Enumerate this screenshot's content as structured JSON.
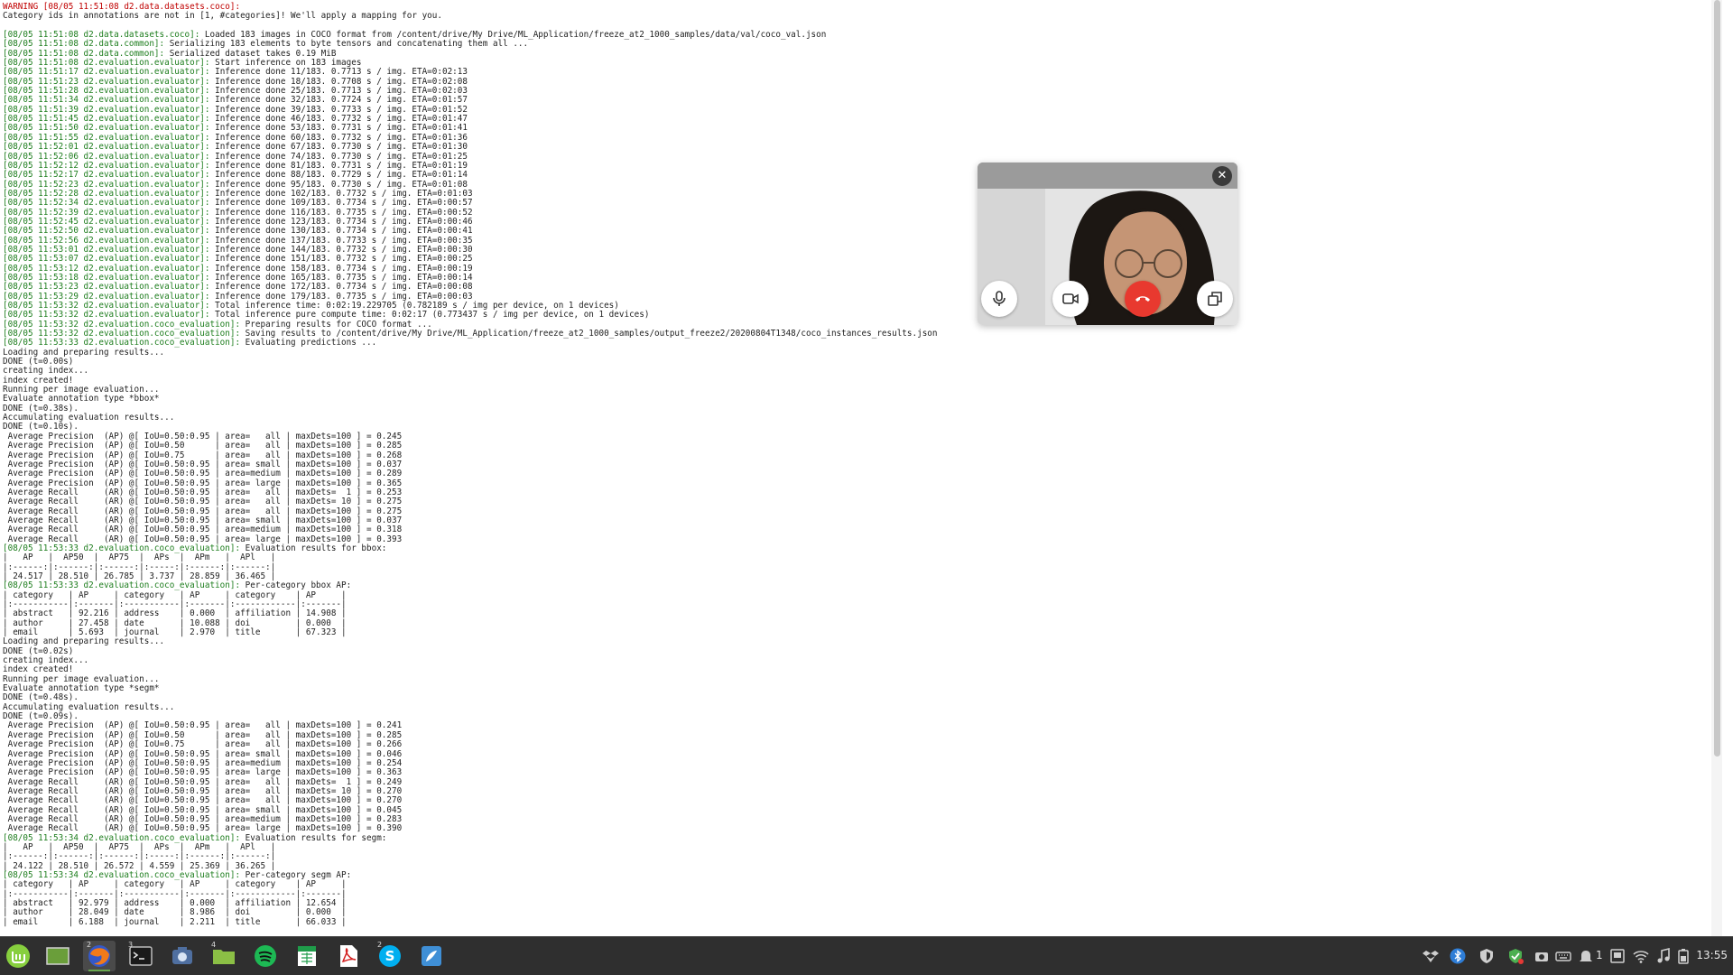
{
  "terminal": {
    "lines": [
      {
        "prefix": "",
        "text": "WARNING [08/05 11:51:08 d2.data.datasets.coco]:",
        "warn": true
      },
      {
        "prefix": "",
        "text": "Category ids in annotations are not in [1, #categories]! We'll apply a mapping for you."
      },
      {
        "prefix": "",
        "text": ""
      },
      {
        "prefix": "[08/05 11:51:08 d2.data.datasets.coco]:",
        "text": " Loaded 183 images in COCO format from /content/drive/My Drive/ML_Application/freeze_at2_1000_samples/data/val/coco_val.json"
      },
      {
        "prefix": "[08/05 11:51:08 d2.data.common]:",
        "text": " Serializing 183 elements to byte tensors and concatenating them all ..."
      },
      {
        "prefix": "[08/05 11:51:08 d2.data.common]:",
        "text": " Serialized dataset takes 0.19 MiB"
      },
      {
        "prefix": "[08/05 11:51:08 d2.evaluation.evaluator]:",
        "text": " Start inference on 183 images"
      },
      {
        "prefix": "[08/05 11:51:17 d2.evaluation.evaluator]:",
        "text": " Inference done 11/183. 0.7713 s / img. ETA=0:02:13"
      },
      {
        "prefix": "[08/05 11:51:23 d2.evaluation.evaluator]:",
        "text": " Inference done 18/183. 0.7708 s / img. ETA=0:02:08"
      },
      {
        "prefix": "[08/05 11:51:28 d2.evaluation.evaluator]:",
        "text": " Inference done 25/183. 0.7713 s / img. ETA=0:02:03"
      },
      {
        "prefix": "[08/05 11:51:34 d2.evaluation.evaluator]:",
        "text": " Inference done 32/183. 0.7724 s / img. ETA=0:01:57"
      },
      {
        "prefix": "[08/05 11:51:39 d2.evaluation.evaluator]:",
        "text": " Inference done 39/183. 0.7733 s / img. ETA=0:01:52"
      },
      {
        "prefix": "[08/05 11:51:45 d2.evaluation.evaluator]:",
        "text": " Inference done 46/183. 0.7732 s / img. ETA=0:01:47"
      },
      {
        "prefix": "[08/05 11:51:50 d2.evaluation.evaluator]:",
        "text": " Inference done 53/183. 0.7731 s / img. ETA=0:01:41"
      },
      {
        "prefix": "[08/05 11:51:55 d2.evaluation.evaluator]:",
        "text": " Inference done 60/183. 0.7732 s / img. ETA=0:01:36"
      },
      {
        "prefix": "[08/05 11:52:01 d2.evaluation.evaluator]:",
        "text": " Inference done 67/183. 0.7730 s / img. ETA=0:01:30"
      },
      {
        "prefix": "[08/05 11:52:06 d2.evaluation.evaluator]:",
        "text": " Inference done 74/183. 0.7730 s / img. ETA=0:01:25"
      },
      {
        "prefix": "[08/05 11:52:12 d2.evaluation.evaluator]:",
        "text": " Inference done 81/183. 0.7731 s / img. ETA=0:01:19"
      },
      {
        "prefix": "[08/05 11:52:17 d2.evaluation.evaluator]:",
        "text": " Inference done 88/183. 0.7729 s / img. ETA=0:01:14"
      },
      {
        "prefix": "[08/05 11:52:23 d2.evaluation.evaluator]:",
        "text": " Inference done 95/183. 0.7730 s / img. ETA=0:01:08"
      },
      {
        "prefix": "[08/05 11:52:28 d2.evaluation.evaluator]:",
        "text": " Inference done 102/183. 0.7732 s / img. ETA=0:01:03"
      },
      {
        "prefix": "[08/05 11:52:34 d2.evaluation.evaluator]:",
        "text": " Inference done 109/183. 0.7734 s / img. ETA=0:00:57"
      },
      {
        "prefix": "[08/05 11:52:39 d2.evaluation.evaluator]:",
        "text": " Inference done 116/183. 0.7735 s / img. ETA=0:00:52"
      },
      {
        "prefix": "[08/05 11:52:45 d2.evaluation.evaluator]:",
        "text": " Inference done 123/183. 0.7734 s / img. ETA=0:00:46"
      },
      {
        "prefix": "[08/05 11:52:50 d2.evaluation.evaluator]:",
        "text": " Inference done 130/183. 0.7734 s / img. ETA=0:00:41"
      },
      {
        "prefix": "[08/05 11:52:56 d2.evaluation.evaluator]:",
        "text": " Inference done 137/183. 0.7733 s / img. ETA=0:00:35"
      },
      {
        "prefix": "[08/05 11:53:01 d2.evaluation.evaluator]:",
        "text": " Inference done 144/183. 0.7732 s / img. ETA=0:00:30"
      },
      {
        "prefix": "[08/05 11:53:07 d2.evaluation.evaluator]:",
        "text": " Inference done 151/183. 0.7732 s / img. ETA=0:00:25"
      },
      {
        "prefix": "[08/05 11:53:12 d2.evaluation.evaluator]:",
        "text": " Inference done 158/183. 0.7734 s / img. ETA=0:00:19"
      },
      {
        "prefix": "[08/05 11:53:18 d2.evaluation.evaluator]:",
        "text": " Inference done 165/183. 0.7735 s / img. ETA=0:00:14"
      },
      {
        "prefix": "[08/05 11:53:23 d2.evaluation.evaluator]:",
        "text": " Inference done 172/183. 0.7734 s / img. ETA=0:00:08"
      },
      {
        "prefix": "[08/05 11:53:29 d2.evaluation.evaluator]:",
        "text": " Inference done 179/183. 0.7735 s / img. ETA=0:00:03"
      },
      {
        "prefix": "[08/05 11:53:32 d2.evaluation.evaluator]:",
        "text": " Total inference time: 0:02:19.229705 (0.782189 s / img per device, on 1 devices)"
      },
      {
        "prefix": "[08/05 11:53:32 d2.evaluation.evaluator]:",
        "text": " Total inference pure compute time: 0:02:17 (0.773437 s / img per device, on 1 devices)"
      },
      {
        "prefix": "[08/05 11:53:32 d2.evaluation.coco_evaluation]:",
        "text": " Preparing results for COCO format ..."
      },
      {
        "prefix": "[08/05 11:53:32 d2.evaluation.coco_evaluation]:",
        "text": " Saving results to /content/drive/My Drive/ML_Application/freeze_at2_1000_samples/output_freeze2/20200804T1348/coco_instances_results.json"
      },
      {
        "prefix": "[08/05 11:53:33 d2.evaluation.coco_evaluation]:",
        "text": " Evaluating predictions ..."
      },
      {
        "prefix": "",
        "text": "Loading and preparing results..."
      },
      {
        "prefix": "",
        "text": "DONE (t=0.00s)"
      },
      {
        "prefix": "",
        "text": "creating index..."
      },
      {
        "prefix": "",
        "text": "index created!"
      },
      {
        "prefix": "",
        "text": "Running per image evaluation..."
      },
      {
        "prefix": "",
        "text": "Evaluate annotation type *bbox*"
      },
      {
        "prefix": "",
        "text": "DONE (t=0.38s)."
      },
      {
        "prefix": "",
        "text": "Accumulating evaluation results..."
      },
      {
        "prefix": "",
        "text": "DONE (t=0.10s)."
      },
      {
        "prefix": "",
        "text": " Average Precision  (AP) @[ IoU=0.50:0.95 | area=   all | maxDets=100 ] = 0.245"
      },
      {
        "prefix": "",
        "text": " Average Precision  (AP) @[ IoU=0.50      | area=   all | maxDets=100 ] = 0.285"
      },
      {
        "prefix": "",
        "text": " Average Precision  (AP) @[ IoU=0.75      | area=   all | maxDets=100 ] = 0.268"
      },
      {
        "prefix": "",
        "text": " Average Precision  (AP) @[ IoU=0.50:0.95 | area= small | maxDets=100 ] = 0.037"
      },
      {
        "prefix": "",
        "text": " Average Precision  (AP) @[ IoU=0.50:0.95 | area=medium | maxDets=100 ] = 0.289"
      },
      {
        "prefix": "",
        "text": " Average Precision  (AP) @[ IoU=0.50:0.95 | area= large | maxDets=100 ] = 0.365"
      },
      {
        "prefix": "",
        "text": " Average Recall     (AR) @[ IoU=0.50:0.95 | area=   all | maxDets=  1 ] = 0.253"
      },
      {
        "prefix": "",
        "text": " Average Recall     (AR) @[ IoU=0.50:0.95 | area=   all | maxDets= 10 ] = 0.275"
      },
      {
        "prefix": "",
        "text": " Average Recall     (AR) @[ IoU=0.50:0.95 | area=   all | maxDets=100 ] = 0.275"
      },
      {
        "prefix": "",
        "text": " Average Recall     (AR) @[ IoU=0.50:0.95 | area= small | maxDets=100 ] = 0.037"
      },
      {
        "prefix": "",
        "text": " Average Recall     (AR) @[ IoU=0.50:0.95 | area=medium | maxDets=100 ] = 0.318"
      },
      {
        "prefix": "",
        "text": " Average Recall     (AR) @[ IoU=0.50:0.95 | area= large | maxDets=100 ] = 0.393"
      },
      {
        "prefix": "[08/05 11:53:33 d2.evaluation.coco_evaluation]:",
        "text": " Evaluation results for bbox:"
      },
      {
        "prefix": "",
        "text": "|   AP   |  AP50  |  AP75  |  APs  |  APm   |  APl   |"
      },
      {
        "prefix": "",
        "text": "|:------:|:------:|:------:|:-----:|:------:|:------:|"
      },
      {
        "prefix": "",
        "text": "| 24.517 | 28.510 | 26.785 | 3.737 | 28.859 | 36.465 |"
      },
      {
        "prefix": "[08/05 11:53:33 d2.evaluation.coco_evaluation]:",
        "text": " Per-category bbox AP:"
      },
      {
        "prefix": "",
        "text": "| category   | AP     | category   | AP     | category    | AP     |"
      },
      {
        "prefix": "",
        "text": "|:-----------|:-------|:-----------|:-------|:------------|:-------|"
      },
      {
        "prefix": "",
        "text": "| abstract   | 92.216 | address    | 0.000  | affiliation | 14.908 |"
      },
      {
        "prefix": "",
        "text": "| author     | 27.458 | date       | 10.088 | doi         | 0.000  |"
      },
      {
        "prefix": "",
        "text": "| email      | 5.693  | journal    | 2.970  | title       | 67.323 |"
      },
      {
        "prefix": "",
        "text": "Loading and preparing results..."
      },
      {
        "prefix": "",
        "text": "DONE (t=0.02s)"
      },
      {
        "prefix": "",
        "text": "creating index..."
      },
      {
        "prefix": "",
        "text": "index created!"
      },
      {
        "prefix": "",
        "text": "Running per image evaluation..."
      },
      {
        "prefix": "",
        "text": "Evaluate annotation type *segm*"
      },
      {
        "prefix": "",
        "text": "DONE (t=0.48s)."
      },
      {
        "prefix": "",
        "text": "Accumulating evaluation results..."
      },
      {
        "prefix": "",
        "text": "DONE (t=0.09s)."
      },
      {
        "prefix": "",
        "text": " Average Precision  (AP) @[ IoU=0.50:0.95 | area=   all | maxDets=100 ] = 0.241"
      },
      {
        "prefix": "",
        "text": " Average Precision  (AP) @[ IoU=0.50      | area=   all | maxDets=100 ] = 0.285"
      },
      {
        "prefix": "",
        "text": " Average Precision  (AP) @[ IoU=0.75      | area=   all | maxDets=100 ] = 0.266"
      },
      {
        "prefix": "",
        "text": " Average Precision  (AP) @[ IoU=0.50:0.95 | area= small | maxDets=100 ] = 0.046"
      },
      {
        "prefix": "",
        "text": " Average Precision  (AP) @[ IoU=0.50:0.95 | area=medium | maxDets=100 ] = 0.254"
      },
      {
        "prefix": "",
        "text": " Average Precision  (AP) @[ IoU=0.50:0.95 | area= large | maxDets=100 ] = 0.363"
      },
      {
        "prefix": "",
        "text": " Average Recall     (AR) @[ IoU=0.50:0.95 | area=   all | maxDets=  1 ] = 0.249"
      },
      {
        "prefix": "",
        "text": " Average Recall     (AR) @[ IoU=0.50:0.95 | area=   all | maxDets= 10 ] = 0.270"
      },
      {
        "prefix": "",
        "text": " Average Recall     (AR) @[ IoU=0.50:0.95 | area=   all | maxDets=100 ] = 0.270"
      },
      {
        "prefix": "",
        "text": " Average Recall     (AR) @[ IoU=0.50:0.95 | area= small | maxDets=100 ] = 0.045"
      },
      {
        "prefix": "",
        "text": " Average Recall     (AR) @[ IoU=0.50:0.95 | area=medium | maxDets=100 ] = 0.283"
      },
      {
        "prefix": "",
        "text": " Average Recall     (AR) @[ IoU=0.50:0.95 | area= large | maxDets=100 ] = 0.390"
      },
      {
        "prefix": "[08/05 11:53:34 d2.evaluation.coco_evaluation]:",
        "text": " Evaluation results for segm:"
      },
      {
        "prefix": "",
        "text": "|   AP   |  AP50  |  AP75  |  APs  |  APm   |  APl   |"
      },
      {
        "prefix": "",
        "text": "|:------:|:------:|:------:|:-----:|:------:|:------:|"
      },
      {
        "prefix": "",
        "text": "| 24.122 | 28.510 | 26.572 | 4.559 | 25.369 | 36.265 |"
      },
      {
        "prefix": "[08/05 11:53:34 d2.evaluation.coco_evaluation]:",
        "text": " Per-category segm AP:"
      },
      {
        "prefix": "",
        "text": "| category   | AP     | category   | AP     | category    | AP     |"
      },
      {
        "prefix": "",
        "text": "|:-----------|:-------|:-----------|:-------|:------------|:-------|"
      },
      {
        "prefix": "",
        "text": "| abstract   | 92.979 | address    | 0.000  | affiliation | 12.654 |"
      },
      {
        "prefix": "",
        "text": "| author     | 28.049 | date       | 8.986  | doi         | 0.000  |"
      },
      {
        "prefix": "",
        "text": "| email      | 6.188  | journal    | 2.211  | title       | 66.033 |"
      }
    ],
    "colors": {
      "text": "#222222",
      "prefix": "#1d7d1d",
      "warning": "#c00000"
    }
  },
  "video_call": {
    "close_icon": "close-icon",
    "buttons": [
      {
        "name": "mute-microphone-button",
        "icon": "microphone-icon"
      },
      {
        "name": "toggle-camera-button",
        "icon": "video-camera-icon"
      },
      {
        "name": "hang-up-button",
        "icon": "phone-hangup-icon",
        "color": "#e8392f"
      },
      {
        "name": "pop-out-button",
        "icon": "window-restore-icon"
      }
    ]
  },
  "taskbar": {
    "apps": [
      {
        "name": "start-menu",
        "icon": "linux-mint-logo-icon"
      },
      {
        "name": "show-desktop",
        "icon": "desktop-icon"
      },
      {
        "name": "firefox",
        "icon": "firefox-icon",
        "active": true,
        "badge": "2"
      },
      {
        "name": "terminal",
        "icon": "terminal-icon",
        "badge": "3"
      },
      {
        "name": "screenshot-tool",
        "icon": "camera-app-icon"
      },
      {
        "name": "file-manager",
        "icon": "folder-icon",
        "badge": "4"
      },
      {
        "name": "spotify",
        "icon": "spotify-icon"
      },
      {
        "name": "spreadsheet",
        "icon": "spreadsheet-icon"
      },
      {
        "name": "pdf-viewer",
        "icon": "pdf-icon"
      },
      {
        "name": "skype",
        "icon": "skype-icon",
        "badge": "2"
      },
      {
        "name": "text-editor",
        "icon": "text-editor-icon"
      }
    ],
    "tray": [
      "dropbox-icon",
      "bluetooth-icon",
      "vpn-shield-icon",
      "update-shield-icon",
      "screenshot-icon",
      "keyboard-icon",
      "notifications-icon",
      "display-icon",
      "wifi-icon",
      "music-icon",
      "battery-icon"
    ],
    "tray_count": "1",
    "clock": "13:55"
  }
}
